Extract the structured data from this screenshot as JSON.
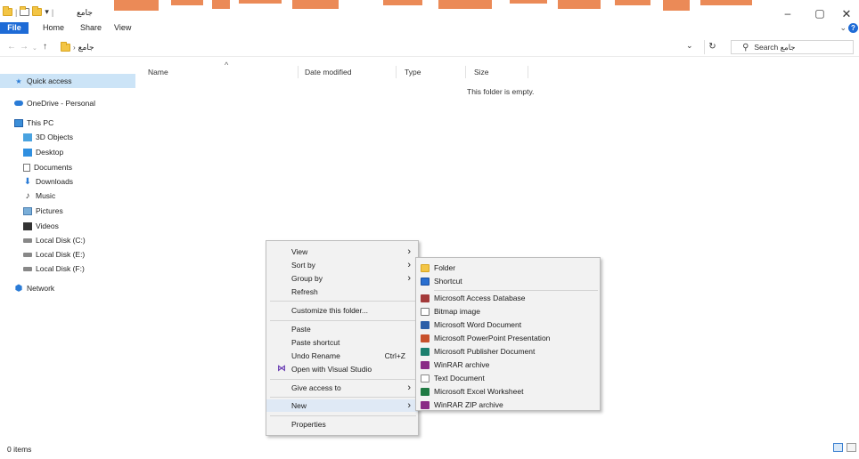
{
  "window": {
    "title": "جامع",
    "minimize": "–",
    "maximize": "▢",
    "close": "✕"
  },
  "quick_access_toolbar": {
    "separator": "|",
    "dropdown": "▾"
  },
  "ribbon": {
    "tabs": [
      "File",
      "Home",
      "Share",
      "View"
    ],
    "expand": "⌄",
    "help": "?"
  },
  "address": {
    "back": "←",
    "forward": "→",
    "recent": "⌄",
    "up": "↑",
    "separator": "›",
    "path": "جامع",
    "dropdown": "⌄",
    "refresh": "↻"
  },
  "search": {
    "icon": "⚲",
    "placeholder": "Search جامع"
  },
  "nav_pane": {
    "items": [
      {
        "label": "Quick access",
        "icon": "star-icon",
        "glyph": "★"
      },
      {
        "label": "OneDrive - Personal",
        "icon": "cloud-icon",
        "glyph": ""
      },
      {
        "label": "This PC",
        "icon": "computer-icon",
        "glyph": ""
      },
      {
        "label": "3D Objects",
        "icon": "cube-icon",
        "glyph": ""
      },
      {
        "label": "Desktop",
        "icon": "desktop-icon",
        "glyph": ""
      },
      {
        "label": "Documents",
        "icon": "document-icon",
        "glyph": ""
      },
      {
        "label": "Downloads",
        "icon": "download-arrow-icon",
        "glyph": "⬇"
      },
      {
        "label": "Music",
        "icon": "music-note-icon",
        "glyph": "♪"
      },
      {
        "label": "Pictures",
        "icon": "picture-icon",
        "glyph": ""
      },
      {
        "label": "Videos",
        "icon": "video-icon",
        "glyph": ""
      },
      {
        "label": "Local Disk (C:)",
        "icon": "drive-icon",
        "glyph": ""
      },
      {
        "label": "Local Disk (E:)",
        "icon": "drive-icon",
        "glyph": ""
      },
      {
        "label": "Local Disk (F:)",
        "icon": "drive-icon",
        "glyph": ""
      },
      {
        "label": "Network",
        "icon": "network-icon",
        "glyph": "⬢"
      }
    ]
  },
  "file_list": {
    "columns": [
      "Name",
      "Date modified",
      "Type",
      "Size"
    ],
    "sort_indicator": "^",
    "empty_message": "This folder is empty."
  },
  "status_bar": {
    "item_count": "0 items"
  },
  "context_menu": {
    "items": [
      {
        "label": "View",
        "has_submenu": true
      },
      {
        "label": "Sort by",
        "has_submenu": true
      },
      {
        "label": "Group by",
        "has_submenu": true
      },
      {
        "label": "Refresh"
      },
      {
        "label": "Customize this folder..."
      },
      {
        "label": "Paste"
      },
      {
        "label": "Paste shortcut"
      },
      {
        "label": "Undo Rename",
        "shortcut": "Ctrl+Z"
      },
      {
        "label": "Open with Visual Studio",
        "icon": "visual-studio-icon"
      },
      {
        "label": "Give access to",
        "has_submenu": true
      },
      {
        "label": "New",
        "has_submenu": true,
        "highlighted": true
      },
      {
        "label": "Properties"
      }
    ],
    "arrow": "›",
    "vs_glyph": "⋈"
  },
  "new_submenu": {
    "items": [
      {
        "label": "Folder",
        "icon": "folder-icon"
      },
      {
        "label": "Shortcut",
        "icon": "shortcut-icon"
      },
      {
        "label": "Microsoft Access Database",
        "icon": "access-icon"
      },
      {
        "label": "Bitmap image",
        "icon": "bitmap-icon"
      },
      {
        "label": "Microsoft Word Document",
        "icon": "word-icon"
      },
      {
        "label": "Microsoft PowerPoint Presentation",
        "icon": "powerpoint-icon"
      },
      {
        "label": "Microsoft Publisher Document",
        "icon": "publisher-icon"
      },
      {
        "label": "WinRAR archive",
        "icon": "winrar-icon"
      },
      {
        "label": "Text Document",
        "icon": "text-document-icon"
      },
      {
        "label": "Microsoft Excel Worksheet",
        "icon": "excel-icon"
      },
      {
        "label": "WinRAR ZIP archive",
        "icon": "winrar-zip-icon"
      }
    ]
  },
  "colors": {
    "accent": "#1e6bd6",
    "selection": "#cce4f7",
    "watermark": "#e8763a"
  }
}
